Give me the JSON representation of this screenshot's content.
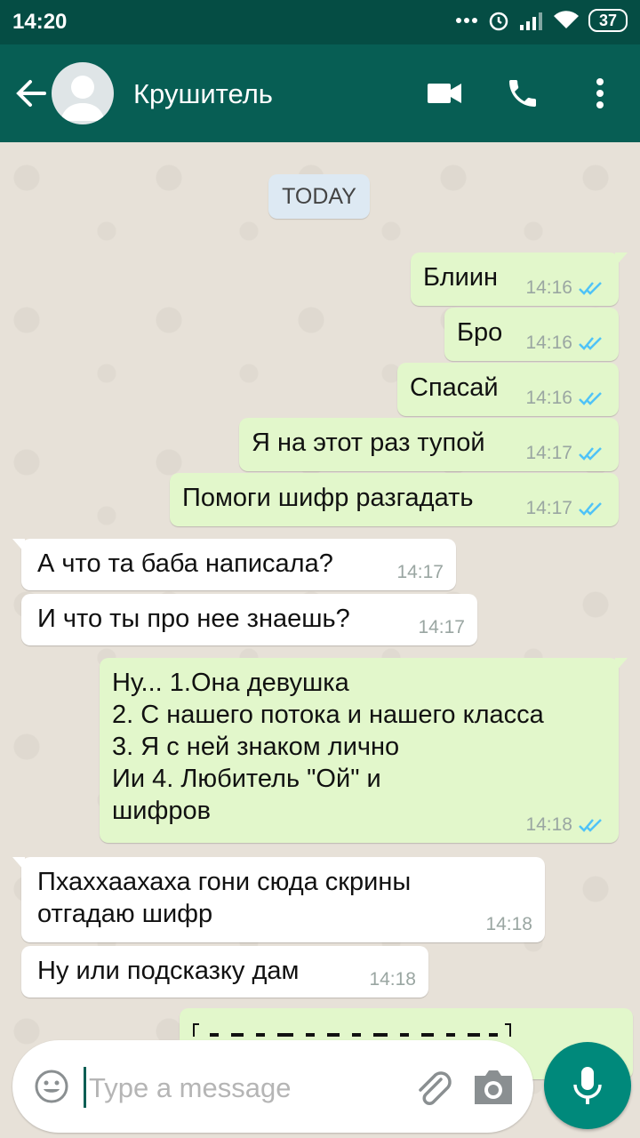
{
  "status_bar": {
    "time": "14:20",
    "battery": "37"
  },
  "header": {
    "contact_name": "Крушитель"
  },
  "chat": {
    "date_label": "TODAY",
    "messages": [
      {
        "dir": "out",
        "text": "Блиин",
        "time": "14:16",
        "status": "read"
      },
      {
        "dir": "out",
        "text": "Бро",
        "time": "14:16",
        "status": "read"
      },
      {
        "dir": "out",
        "text": "Спасай",
        "time": "14:16",
        "status": "read"
      },
      {
        "dir": "out",
        "text": "Я на этот раз тупой",
        "time": "14:17",
        "status": "read"
      },
      {
        "dir": "out",
        "text": "Помоги шифр разгадать",
        "time": "14:17",
        "status": "read"
      },
      {
        "dir": "in",
        "text": "А что та баба написала?",
        "time": "14:17"
      },
      {
        "dir": "in",
        "text": "И что ты про нее знаешь?",
        "time": "14:17"
      },
      {
        "dir": "out",
        "text": "Ну... 1.Она девушка\n2. С нашего потока и нашего класса\n3. Я с ней знаком лично\nИи 4. Любитель \"Ой\" и\nшифров",
        "time": "14:18",
        "status": "read"
      },
      {
        "dir": "in",
        "text": "Пхаххаахаха гони сюда скрины\nотгадаю шифр",
        "time": "14:18"
      },
      {
        "dir": "in",
        "text": "Ну или подсказку дам",
        "time": "14:18"
      }
    ]
  },
  "composer": {
    "placeholder": "Type a message"
  },
  "colors": {
    "header": "#075e54",
    "status_bar": "#054d44",
    "outgoing": "#e2f7cb",
    "incoming": "#ffffff",
    "read_ticks": "#4fc3f7",
    "fab": "#00897b"
  },
  "icons": [
    "back-arrow-icon",
    "avatar-icon",
    "video-call-icon",
    "phone-icon",
    "more-vert-icon",
    "emoji-icon",
    "attach-icon",
    "camera-icon",
    "mic-icon",
    "double-check-icon"
  ]
}
